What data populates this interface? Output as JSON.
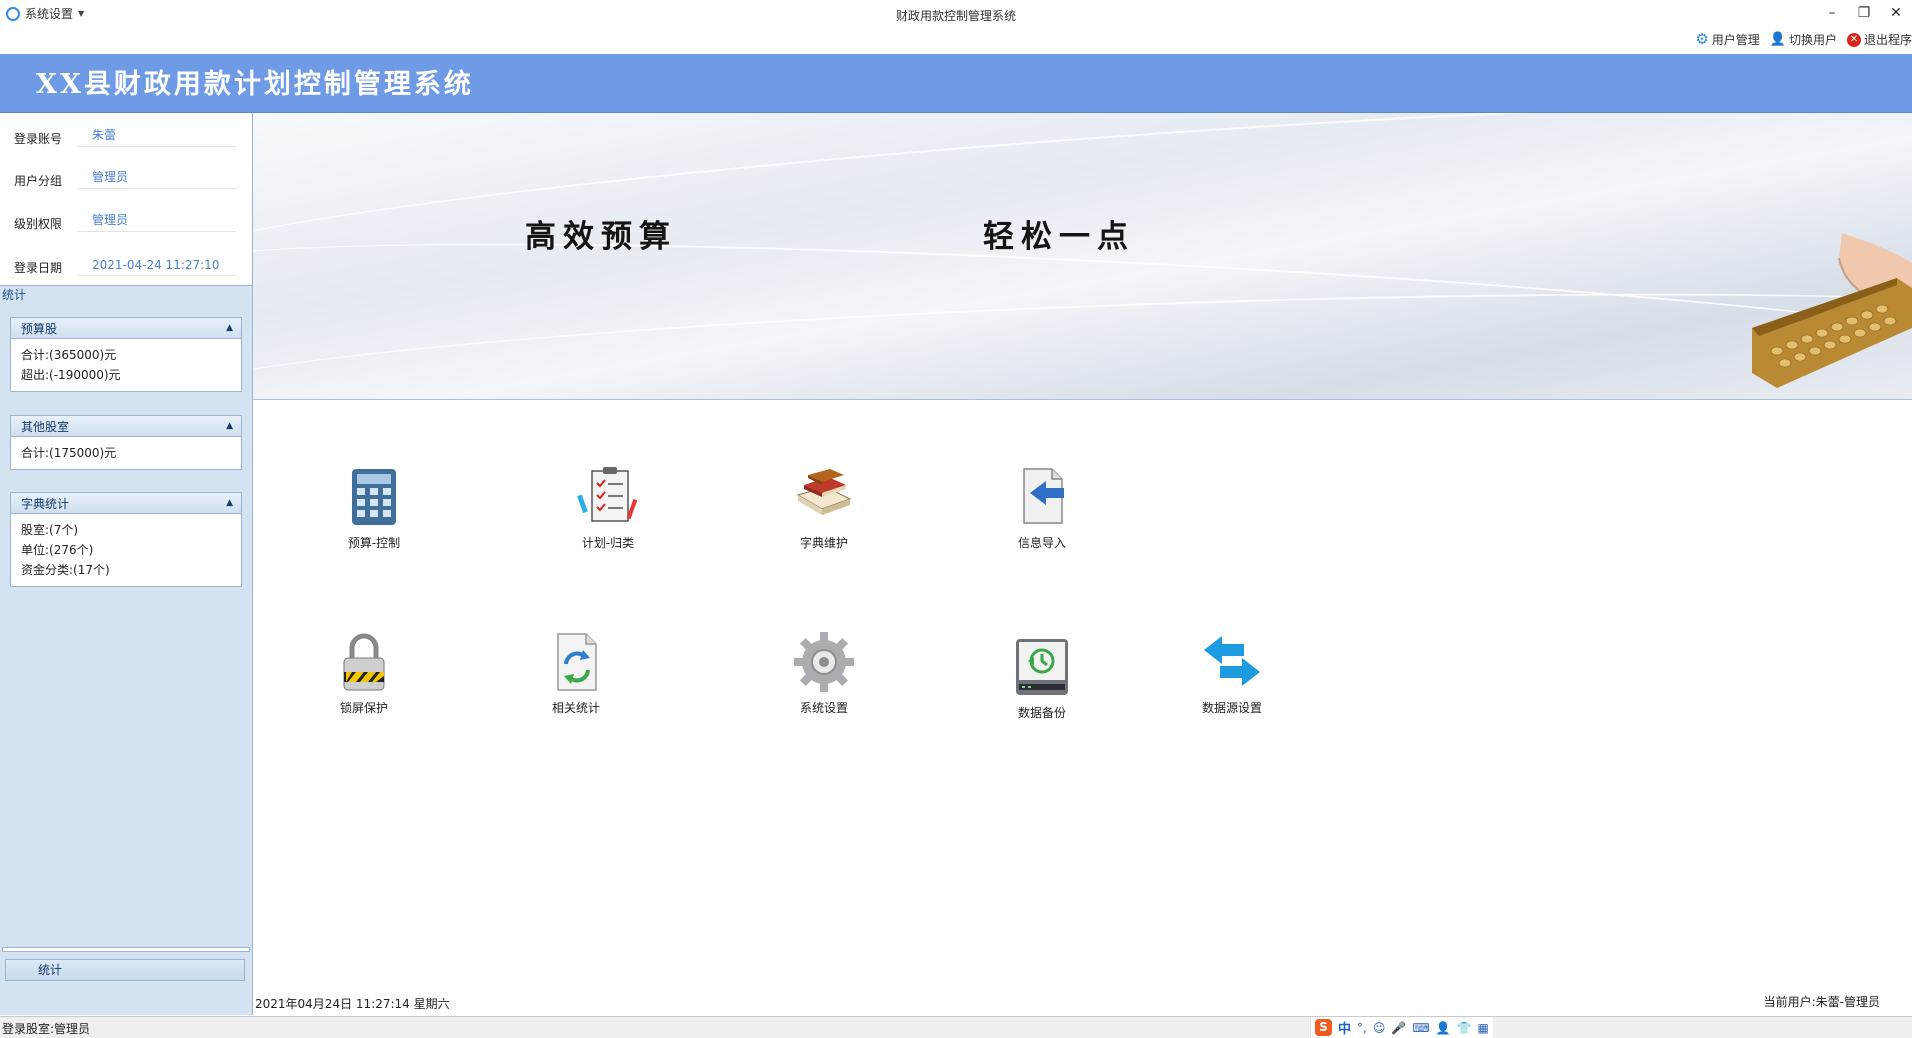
{
  "window": {
    "menu_label": "系统设置",
    "title": "财政用款控制管理系统"
  },
  "toplinks": {
    "user_mgmt": "用户管理",
    "switch_user": "切换用户",
    "exit": "退出程序"
  },
  "header": {
    "app_title": "XX县财政用款计划控制管理系统"
  },
  "userinfo": {
    "account_label": "登录账号",
    "account_value": "朱蕾",
    "group_label": "用户分组",
    "group_value": "管理员",
    "level_label": "级别权限",
    "level_value": "管理员",
    "date_label": "登录日期",
    "date_value": "2021-04-24 11:27:10"
  },
  "stats": {
    "tab_label": "统计",
    "groups": [
      {
        "title": "预算股",
        "lines": [
          "合计:(365000)元",
          "超出:(-190000)元"
        ]
      },
      {
        "title": "其他股室",
        "lines": [
          "合计:(175000)元"
        ]
      },
      {
        "title": "字典统计",
        "lines": [
          "股室:(7个)",
          "单位:(276个)",
          "资金分类:(17个)"
        ]
      }
    ],
    "button_label": "统计"
  },
  "banner": {
    "slogan_left": "高效预算",
    "slogan_right": "轻松一点"
  },
  "tiles": {
    "budget_control": "预算-控制",
    "plan_classify": "计划-归类",
    "dict_maintain": "字典维护",
    "info_import": "信息导入",
    "lock_screen": "锁屏保护",
    "related_stats": "相关统计",
    "system_settings": "系统设置",
    "data_backup": "数据备份",
    "datasource_settings": "数据源设置"
  },
  "status": {
    "datetime": "2021年04月24日 11:27:14 星期六",
    "current_user": "当前用户:朱蕾-管理员",
    "dept": "登录股室:管理员"
  },
  "ime": {
    "logo": "S",
    "mode": "中"
  }
}
